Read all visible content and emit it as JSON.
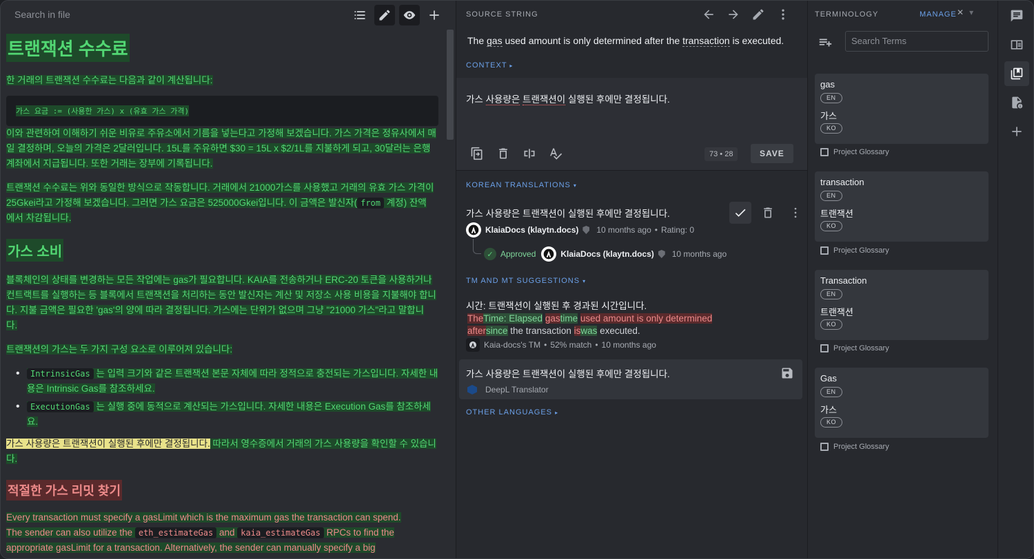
{
  "left": {
    "search_placeholder": "Search in file",
    "h1": "트랜잭션 수수료",
    "p1": "한 거래의 트랜잭션 수수료는 다음과 같이 계산됩니다:",
    "code1": "가스 요금 := (사용한 가스) x (유효 가스 가격)",
    "p2a": "이와 관련하여 이해하기 쉬운 비유로 주유소에서 기름을 넣는다고 가정해 보겠습니다. 가스 가격은 정유사에서 매",
    "p2b": "일 결정하며, 오늘의 가격은 2달러입니다. 15L를 주유하면 $30 = 15L x $2/1L를 지불하게 되고, 30달러는 은행",
    "p2c": "계좌에서 지급됩니다. 또한 거래는 장부에 기록됩니다.",
    "p3a": "트랜잭션 수수료는 위와 동일한 방식으로 작동합니다. 거래에서 21000가스를 사용했고 거래의 유효 가스 가격이",
    "p3b_pre": "25Gkei라고 가정해 보겠습니다. 그러면 가스 요금은 525000Gkei입니다. 이 금액은 발신자(",
    "p3b_code": "from",
    "p3b_post": " 계정) 잔액",
    "p3c": "에서 차감됩니다.",
    "h2": "가스 소비",
    "p4a": "블록체인의 상태를 변경하는 모든 작업에는 gas가 필요합니다. KAIA를 전송하거나 ERC-20 토큰을 사용하거나",
    "p4b": "컨트랙트를 실행하는 등 블록에서 트랜잭션을 처리하는 동안 발신자는 계산 및 저장소 사용 비용을 지불해야 합니",
    "p4c": "다. 지불 금액은 필요한 'gas'의 양에 따라 결정됩니다. 가스에는 단위가 없으며 그냥 \"21000 가스\"라고 말합니",
    "p4d": "다.",
    "p5": "트랜잭션의 가스는 두 가지 구성 요소로 이루어져 있습니다:",
    "li1_code": "IntrinsicGas",
    "li1a": " 는 입력 크기와 같은 트랜잭션 본문 자체에 따라 정적으로 충전되는 가스입니다. 자세한 내",
    "li1b": "용은 Intrinsic Gas를 참조하세요.",
    "li2_code": "ExecutionGas",
    "li2a": " 는 실행 중에 동적으로 계산되는 가스입니다. 자세한 내용은 Execution Gas를 참조하세",
    "li2b": "요.",
    "p6_highlight": "가스 사용량은 트랜잭션이 실행된 후에만 결정됩니다.",
    "p6_rest": " 따라서 영수증에서 거래의 가스 사용량을 확인할 수 있습니",
    "p6b": "다.",
    "h3": "적절한 가스 리밋 찾기",
    "p7a": "Every transaction must specify a gasLimit which is the maximum gas the transaction can spend.",
    "p7b_pre": "The sender can also utilize the ",
    "p7b_code1": "eth_estimateGas",
    "p7b_mid": " and ",
    "p7b_code2": "kaia_estimateGas",
    "p7b_post": " RPCs to find the",
    "p7c": "appropriate gasLimit for a transaction. Alternatively, the sender can manually specify a big"
  },
  "mid": {
    "title": "SOURCE STRING",
    "source_pre": "The ",
    "source_gas": "gas",
    "source_mid": " used amount is only determined after the ",
    "source_tx": "transaction",
    "source_post": " is executed.",
    "context": "CONTEXT",
    "editor_pre": "가스 ",
    "editor_u1": "사용량은",
    "editor_mid": " ",
    "editor_u2": "트랜잭션이",
    "editor_post": " 실행된 후에만 결정됩니다.",
    "counter": "73 • 28",
    "save": "SAVE",
    "korean_translations": "KOREAN TRANSLATIONS",
    "translation": "가스 사용량은 트랜잭션이 실행된 후에만 결정됩니다.",
    "author": "KlaiaDocs (klaytn.docs)",
    "time": "10 months ago",
    "rating": "Rating: 0",
    "approved": "Approved",
    "approver": "KlaiaDocs (klaytn.docs)",
    "approved_time": "10 months ago",
    "tm_head": "TM AND MT SUGGESTIONS",
    "tm_text": "시간: 트랜잭션이 실행된 후 경과된 시간입니다.",
    "diff": {
      "d1": "The",
      "i1": "Time: Elapsed",
      "s1": " ",
      "d2": "gas",
      "i2": "time",
      "s2": " ",
      "d3": "used amount is only determined",
      "s3": " ",
      "d4": "after",
      "i4": "since",
      "s4": " the transaction ",
      "d5": "is",
      "i5": "was",
      "s5": " executed."
    },
    "tm_source": "Kaia-docs's TM",
    "tm_match": "52% match",
    "tm_time": "10 months ago",
    "mt_text": "가스 사용량은 트랜잭션이 실행된 후에만 결정됩니다.",
    "mt_source": "DeepL Translator",
    "other_languages": "OTHER LANGUAGES"
  },
  "terminology": {
    "title": "TERMINOLOGY",
    "manage": "MANAGE",
    "search_placeholder": "Search Terms",
    "cards": [
      {
        "term": "gas",
        "src_lang": "EN",
        "translation": "가스",
        "tr_lang": "KO",
        "glossary": "Project Glossary"
      },
      {
        "term": "transaction",
        "src_lang": "EN",
        "translation": "트랜잭션",
        "tr_lang": "KO",
        "glossary": "Project Glossary"
      },
      {
        "term": "Transaction",
        "src_lang": "EN",
        "translation": "트랜잭션",
        "tr_lang": "KO",
        "glossary": "Project Glossary"
      },
      {
        "term": "Gas",
        "src_lang": "EN",
        "translation": "가스",
        "tr_lang": "KO",
        "glossary": "Project Glossary"
      }
    ]
  },
  "colors": {
    "accent": "#6ba0e8",
    "highlight_green": "#52d773",
    "highlight_red": "#ec8a8a",
    "highlight_yellow": "#e9e28a"
  }
}
